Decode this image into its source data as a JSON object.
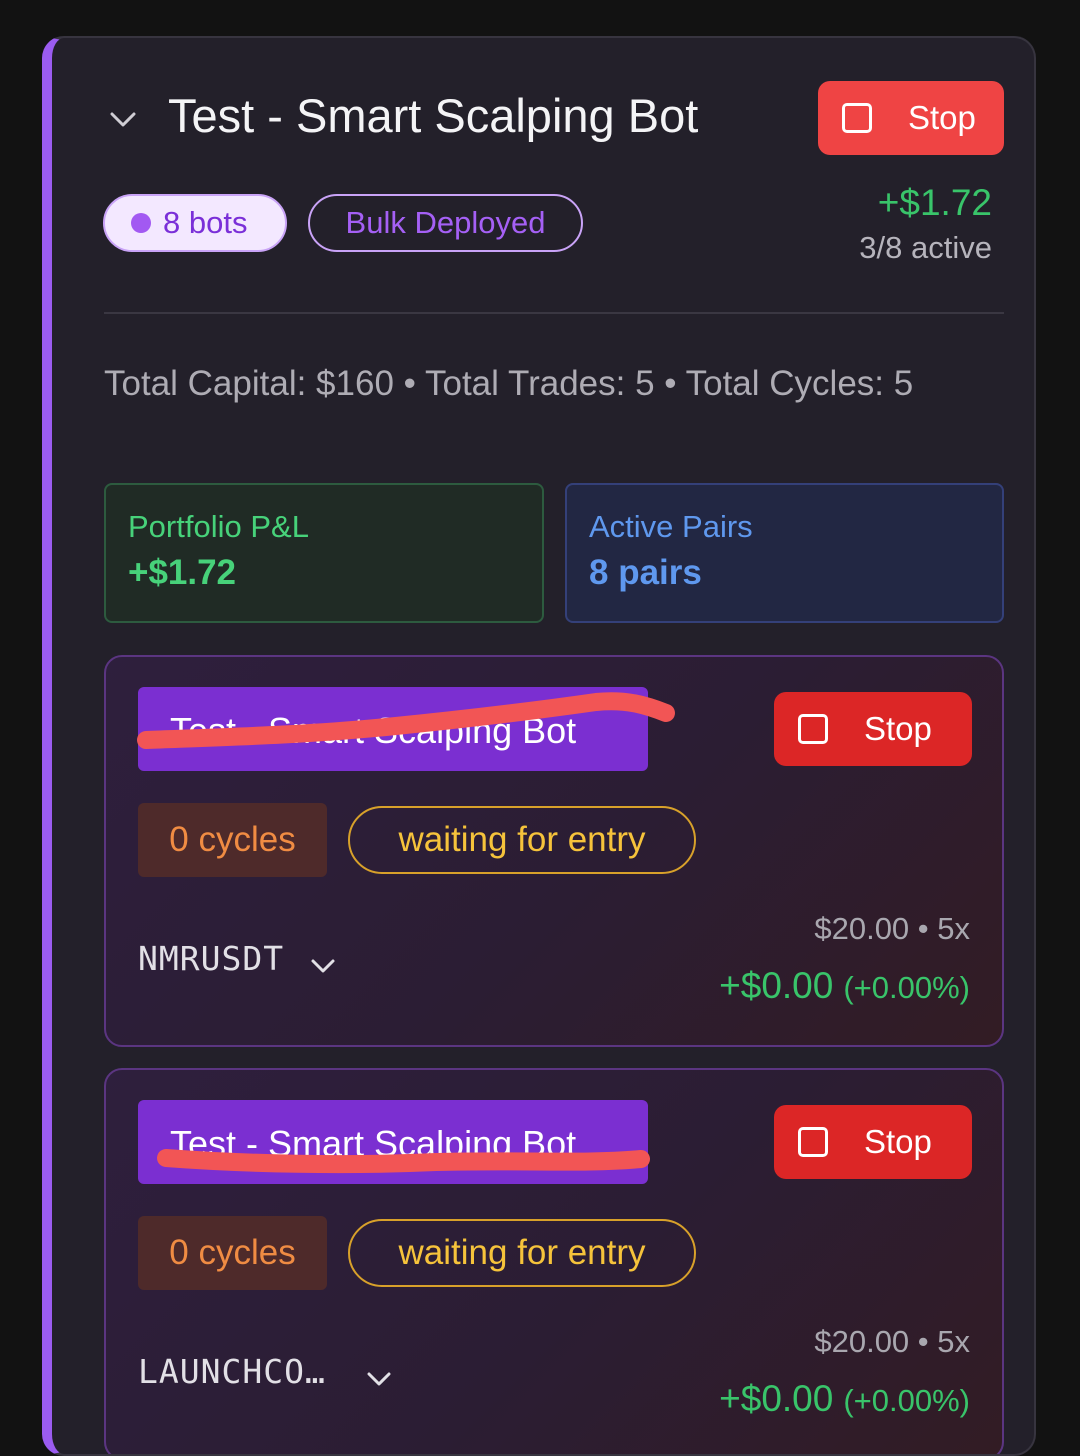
{
  "group": {
    "title": "Test - Smart Scalping Bot",
    "stop_label": "Stop",
    "bots_badge": "8 bots",
    "deploy_badge": "Bulk Deployed",
    "pnl": "+$1.72",
    "active": "3/8 active",
    "summary": "Total Capital: $160 • Total Trades: 5 • Total Cycles: 5",
    "stats": {
      "pnl_label": "Portfolio P&L",
      "pnl_value": "+$1.72",
      "pairs_label": "Active Pairs",
      "pairs_value": "8 pairs"
    }
  },
  "bots": [
    {
      "name": "Test - Smart Scalping Bot",
      "stop_label": "Stop",
      "cycles": "0 cycles",
      "status": "waiting for entry",
      "symbol": "NMRUSDT",
      "capital": "$20.00 • 5x",
      "pnl": "+$0.00",
      "pnl_pct": "(+0.00%)"
    },
    {
      "name": "Test - Smart Scalping Bot",
      "stop_label": "Stop",
      "cycles": "0 cycles",
      "status": "waiting for entry",
      "symbol": "LAUNCHCO…",
      "capital": "$20.00 • 5x",
      "pnl": "+$0.00",
      "pnl_pct": "(+0.00%)"
    }
  ],
  "colors": {
    "accent": "#9b5cf0",
    "stop": "#ef4444",
    "profit": "#39c46a",
    "pairs": "#5f98ee",
    "status": "#f6c33b",
    "scribble": "#f25555"
  }
}
